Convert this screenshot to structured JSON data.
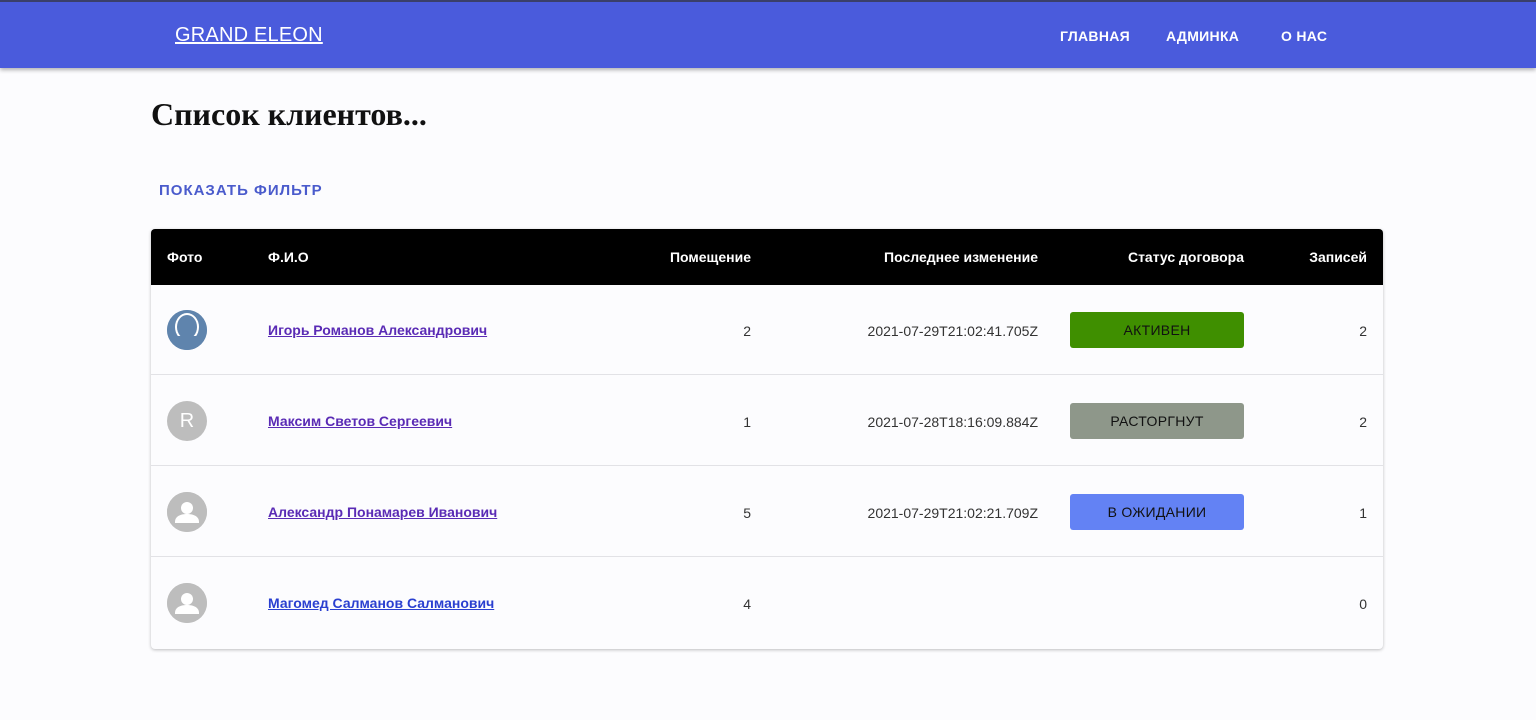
{
  "header": {
    "brand": "GRAND ELEON",
    "nav": [
      "ГЛАВНАЯ",
      "АДМИНКА",
      "О НАС"
    ]
  },
  "page_title": "Список клиентов...",
  "filter_button": "ПОКАЗАТЬ ФИЛЬТР",
  "table": {
    "columns": [
      "Фото",
      "Ф.И.О",
      "Помещение",
      "Последнее изменение",
      "Статус договора",
      "Записей"
    ],
    "rows": [
      {
        "avatar": "blue-silhouette-photo",
        "name": "Игорь Романов Александрович",
        "room": "2",
        "modified": "2021-07-29T21:02:41.705Z",
        "status": "АКТИВЕН",
        "status_color": "#3f8f00",
        "records": "2"
      },
      {
        "avatar": "letter-avatar",
        "avatar_letter": "R",
        "name": "Максим Светов Сергеевич",
        "room": "1",
        "modified": "2021-07-28T18:16:09.884Z",
        "status": "РАСТОРГНУТ",
        "status_color": "#8e978a",
        "records": "2"
      },
      {
        "avatar": "person-icon",
        "name": "Александр Понамарев Иванович",
        "room": "5",
        "modified": "2021-07-29T21:02:21.709Z",
        "status": "В ОЖИДАНИИ",
        "status_color": "#6382f4",
        "records": "1"
      },
      {
        "avatar": "person-icon",
        "name": "Магомед Салманов Салманович",
        "room": "4",
        "modified": "",
        "status": "",
        "records": "0"
      }
    ]
  },
  "colors": {
    "appbar": "#4a5bdc",
    "table_header": "#000000",
    "link_visited": "#5a2bb5",
    "link": "#2a3fd0"
  }
}
